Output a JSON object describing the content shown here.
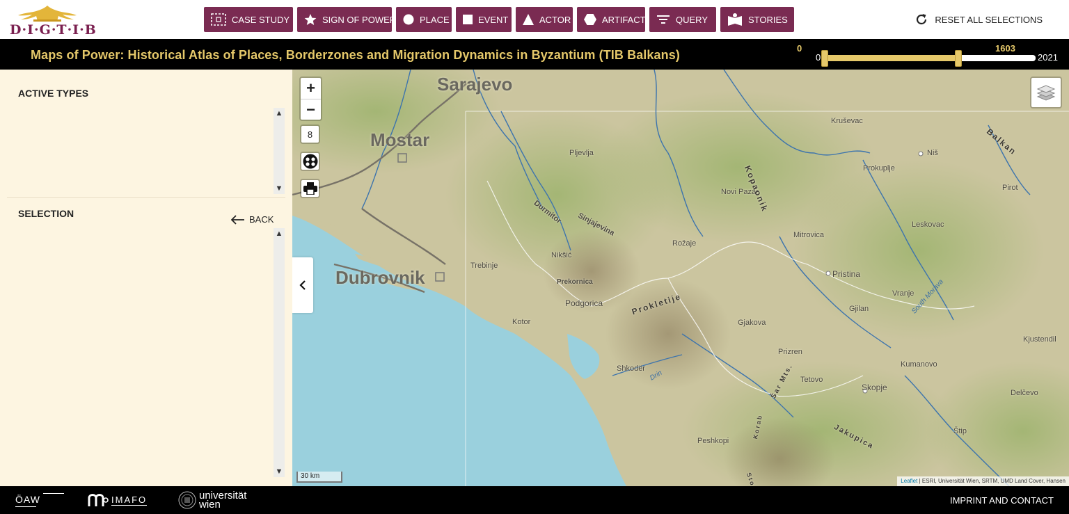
{
  "logo": {
    "text": "D·I·G·T·I·B",
    "color": "#7a1f4f"
  },
  "nav": {
    "items": [
      {
        "label": "Case Study",
        "icon": "case-study-icon"
      },
      {
        "label": "Sign of Power",
        "icon": "star-icon"
      },
      {
        "label": "Place",
        "icon": "circle-icon"
      },
      {
        "label": "Event",
        "icon": "square-icon"
      },
      {
        "label": "Actor",
        "icon": "triangle-icon"
      },
      {
        "label": "Artifact",
        "icon": "hexagon-icon"
      },
      {
        "label": "Query",
        "icon": "filter-icon"
      },
      {
        "label": "Stories",
        "icon": "book-icon"
      }
    ],
    "button_color": "#7a2b52",
    "reset_label": "RESET ALL SELECTIONS"
  },
  "title": "Maps of Power: Historical Atlas of Places, Borderzones and Migration Dynamics in Byzantium (TIB Balkans)",
  "title_color": "#e5c86a",
  "timeline": {
    "min": "0",
    "max": "2021",
    "lower": "0",
    "upper": "1603",
    "lower_value": 0,
    "upper_value": 1603
  },
  "sidebar": {
    "active_types_title": "ACTIVE TYPES",
    "selection_title": "SELECTION",
    "back_label": "BACK",
    "background": "#fdf5e1"
  },
  "map": {
    "zoom_in": "+",
    "zoom_out": "−",
    "zoom_level": "8",
    "scale": "30 km",
    "attribution_leaflet": "Leaflet",
    "attribution_rest": " | ESRI, Universität Wien, SRTM, UMD Land Cover, Hansen",
    "labels": {
      "sarajevo": "Sarajevo",
      "mostar": "Mostar",
      "dubrovnik": "Dubrovnik",
      "krusevac": "Kruševac",
      "nis": "Niš",
      "pljevlja": "Pljevlja",
      "prokuplje": "Prokuplje",
      "pirot": "Pirot",
      "novi_pazar": "Novi Pazar",
      "kopaonik": "Kopaonik",
      "balkan": "Balkan",
      "durmitor": "Durmitor",
      "sinjajevina": "Sinjajevina",
      "niksic": "Nikšić",
      "rozaje": "Rožaje",
      "mitrovica": "Mitrovica",
      "leskovac": "Leskovac",
      "trebinje": "Trebinje",
      "pristina": "Pristina",
      "prekornica": "Prekornica",
      "vranje": "Vranje",
      "south_morava": "South Morava",
      "podgorica": "Podgorica",
      "prokletije": "Prokletije",
      "gjilan": "Gjilan",
      "kotor": "Kotor",
      "gjakova": "Gjakova",
      "kjustendil": "Kjustendil",
      "prizren": "Prizren",
      "kumanovo": "Kumanovo",
      "shkoder": "Shkodër",
      "drin": "Drin",
      "tetovo": "Tetovo",
      "skopje": "Skopje",
      "delcevo": "Delčevo",
      "sar_mts": "Šar Mts.",
      "stip": "Štip",
      "peshkopi": "Peshkopi",
      "jakupica": "Jakupica",
      "korab": "Korab",
      "ston": "Ston"
    }
  },
  "footer": {
    "oaw": "ÖAW",
    "imafo": "IMAFO",
    "univie_line1": "universität",
    "univie_line2": "wien",
    "imprint": "IMPRINT AND CONTACT"
  }
}
